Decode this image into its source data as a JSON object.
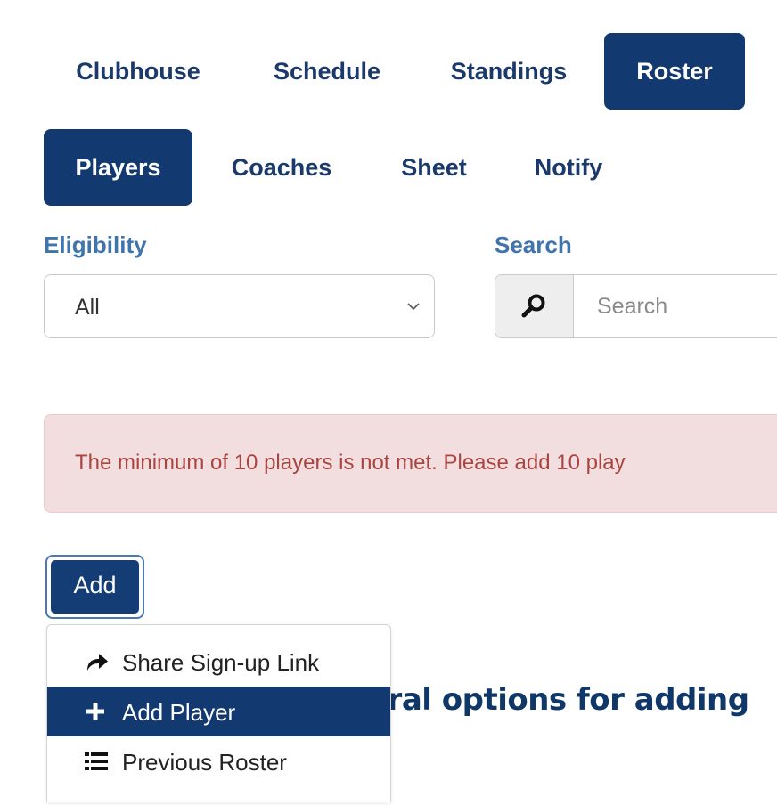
{
  "nav": {
    "tabs": [
      "Clubhouse",
      "Schedule",
      "Standings",
      "Roster"
    ],
    "active": "Roster"
  },
  "subnav": {
    "tabs": [
      "Players",
      "Coaches",
      "Sheet",
      "Notify"
    ],
    "active": "Players"
  },
  "filters": {
    "eligibility_label": "Eligibility",
    "eligibility_value": "All",
    "search_label": "Search",
    "search_placeholder": "Search"
  },
  "alert": {
    "text": "The minimum of 10 players is not met. Please add 10 play"
  },
  "add_button": {
    "label": "Add"
  },
  "dropdown": {
    "items": [
      {
        "label": "Share Sign-up Link",
        "icon": "share-icon"
      },
      {
        "label": "Add Player",
        "icon": "plus-icon"
      },
      {
        "label": "Previous Roster",
        "icon": "list-icon"
      }
    ],
    "highlighted": "Add Player"
  },
  "background_heading": {
    "text": "eral options for adding"
  },
  "colors": {
    "primary": "#123a70",
    "label_blue": "#3f74ad",
    "alert_bg": "#f2dede",
    "alert_text": "#a94442"
  }
}
